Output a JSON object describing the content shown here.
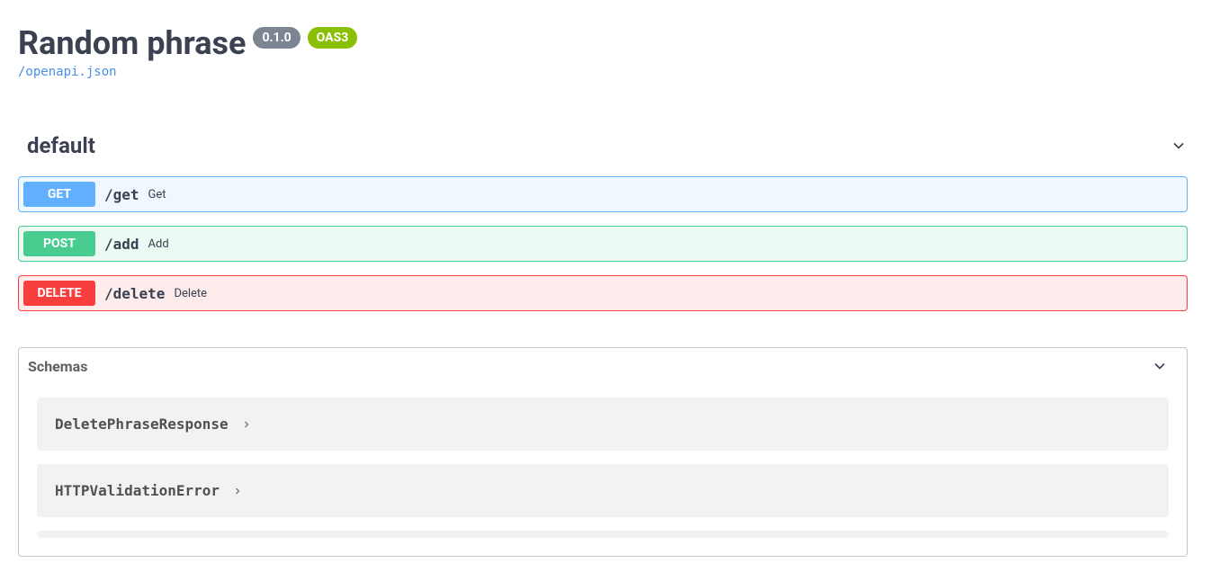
{
  "header": {
    "title": "Random phrase",
    "version": "0.1.0",
    "oas_label": "OAS3",
    "spec_link": "/openapi.json"
  },
  "section": {
    "name": "default"
  },
  "operations": [
    {
      "method": "GET",
      "method_class": "get",
      "path": "/get",
      "summary": "Get"
    },
    {
      "method": "POST",
      "method_class": "post",
      "path": "/add",
      "summary": "Add"
    },
    {
      "method": "DELETE",
      "method_class": "delete",
      "path": "/delete",
      "summary": "Delete"
    }
  ],
  "models": {
    "title": "Schemas",
    "items": [
      {
        "name": "DeletePhraseResponse"
      },
      {
        "name": "HTTPValidationError"
      }
    ]
  }
}
